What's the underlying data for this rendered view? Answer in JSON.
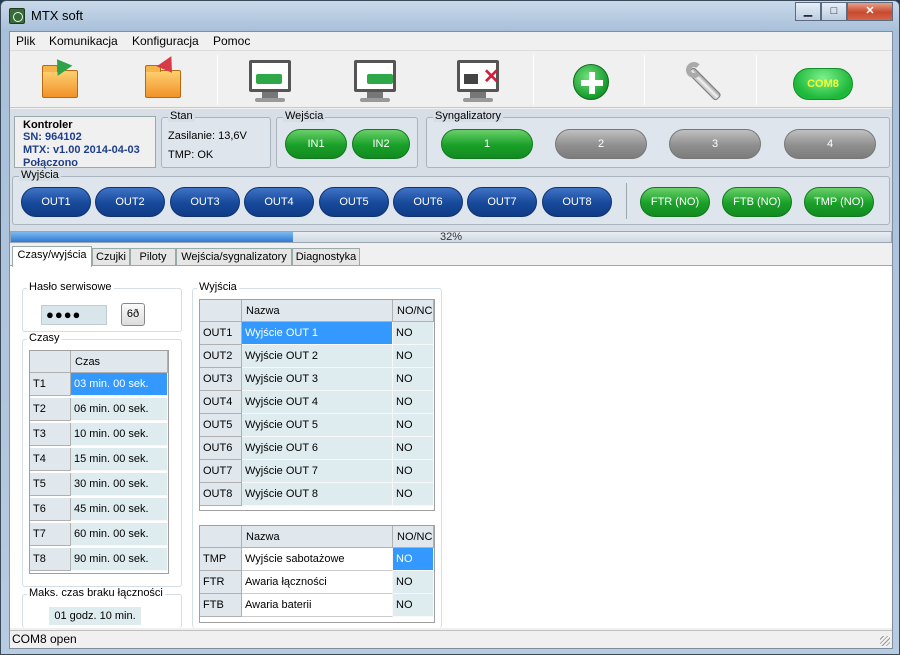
{
  "window": {
    "title": "MTX soft",
    "minimize": "▁",
    "maximize": "□",
    "close": "✕"
  },
  "menu": [
    "Plik",
    "Komunikacja",
    "Konfiguracja",
    "Pomoc"
  ],
  "toolbar": {
    "com_label": "COM8"
  },
  "controller": {
    "group": "Kontroler",
    "sn": "SN:  964102",
    "version": "MTX: v1.00 2014-04-03",
    "status": "Połączono"
  },
  "stan": {
    "group": "Stan",
    "zasilanie": "Zasilanie: 13,6V",
    "tmp": "TMP: OK"
  },
  "wejscia": {
    "group": "Wejścia",
    "items": [
      "IN1",
      "IN2"
    ]
  },
  "syngalizatory": {
    "group": "Syngalizatory",
    "items": [
      "1",
      "2",
      "3",
      "4"
    ]
  },
  "wyjscia_bar": {
    "group": "Wyjścia",
    "outs": [
      "OUT1",
      "OUT2",
      "OUT3",
      "OUT4",
      "OUT5",
      "OUT6",
      "OUT7",
      "OUT8"
    ],
    "faults": [
      "FTR (NO)",
      "FTB (NO)",
      "TMP (NO)"
    ]
  },
  "progress": {
    "value": 0.32,
    "text": "32%"
  },
  "tabs": [
    "Czasy/wyjścia",
    "Czujki",
    "Piloty",
    "Wejścia/sygnalizatory",
    "Diagnostyka"
  ],
  "haslo": {
    "label": "Hasło serwisowe",
    "value": "●●●●",
    "eye": "6ð"
  },
  "czasy": {
    "label": "Czasy",
    "header": "Czas",
    "rows": [
      {
        "id": "T1",
        "value": "03 min. 00 sek."
      },
      {
        "id": "T2",
        "value": "06 min. 00 sek."
      },
      {
        "id": "T3",
        "value": "10 min. 00 sek."
      },
      {
        "id": "T4",
        "value": "15 min. 00 sek."
      },
      {
        "id": "T5",
        "value": "30 min. 00 sek."
      },
      {
        "id": "T6",
        "value": "45 min. 00 sek."
      },
      {
        "id": "T7",
        "value": "60 min. 00 sek."
      },
      {
        "id": "T8",
        "value": "90 min. 00 sek."
      }
    ]
  },
  "maks": {
    "label": "Maks. czas braku łączności",
    "value": "01 godz. 10 min."
  },
  "wyjscia_table": {
    "label": "Wyjścia",
    "headers": [
      "Nazwa",
      "NO/NC"
    ],
    "rows": [
      {
        "id": "OUT1",
        "name": "Wyjście OUT 1",
        "mode": "NO"
      },
      {
        "id": "OUT2",
        "name": "Wyjście OUT 2",
        "mode": "NO"
      },
      {
        "id": "OUT3",
        "name": "Wyjście OUT 3",
        "mode": "NO"
      },
      {
        "id": "OUT4",
        "name": "Wyjście OUT 4",
        "mode": "NO"
      },
      {
        "id": "OUT5",
        "name": "Wyjście OUT 5",
        "mode": "NO"
      },
      {
        "id": "OUT6",
        "name": "Wyjście OUT 6",
        "mode": "NO"
      },
      {
        "id": "OUT7",
        "name": "Wyjście OUT 7",
        "mode": "NO"
      },
      {
        "id": "OUT8",
        "name": "Wyjście OUT 8",
        "mode": "NO"
      }
    ]
  },
  "alarm_table": {
    "headers": [
      "Nazwa",
      "NO/NC"
    ],
    "rows": [
      {
        "id": "TMP",
        "name": "Wyjście sabotażowe",
        "mode": "NO"
      },
      {
        "id": "FTR",
        "name": "Awaria łączności",
        "mode": "NO"
      },
      {
        "id": "FTB",
        "name": "Awaria baterii",
        "mode": "NO"
      }
    ]
  },
  "statusbar": {
    "text": "COM8 open"
  },
  "colors": {
    "accent_blue": "#17489a",
    "active_green": "#18a028",
    "inactive_gray": "#8f8f8f",
    "selection": "#3399ff",
    "com_text": "#f5ff33"
  }
}
